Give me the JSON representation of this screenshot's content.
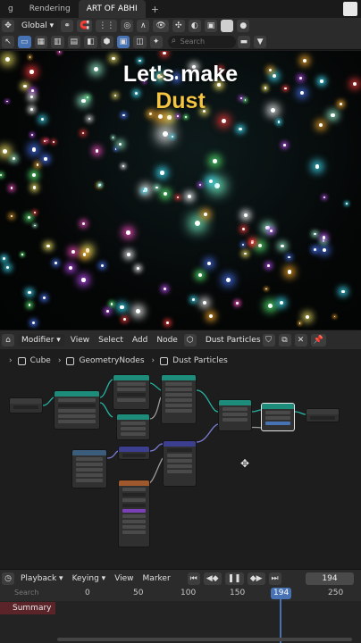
{
  "tabs": {
    "rendering": "Rendering",
    "art": "ART OF ABHI",
    "add": "+",
    "partial": "g"
  },
  "toolbar": {
    "transform_orientation": "Global",
    "search_placeholder": "Search"
  },
  "viewport": {
    "caption_line1": "Let's make",
    "caption_line2": "Dust"
  },
  "node_editor": {
    "editor_type": "Modifier",
    "menus": [
      "View",
      "Select",
      "Add",
      "Node"
    ],
    "tree_name": "Dust Particles",
    "breadcrumbs": [
      "Cube",
      "GeometryNodes",
      "Dust Particles"
    ]
  },
  "timeline": {
    "menus": [
      "Playback",
      "Keying",
      "View",
      "Marker"
    ],
    "current_frame": "194",
    "ruler_ticks": [
      "0",
      "50",
      "100",
      "150",
      "194",
      "250"
    ],
    "search_placeholder": "Search",
    "summary_label": "Summary"
  },
  "colors": {
    "accent": "#4772b3",
    "caption_highlight": "#f4c542",
    "node_geometry_header": "#1d8c7a",
    "node_input_header": "#3b5c7a",
    "node_texture_header": "#a0582d",
    "node_vector_header": "#3c3f8f"
  }
}
